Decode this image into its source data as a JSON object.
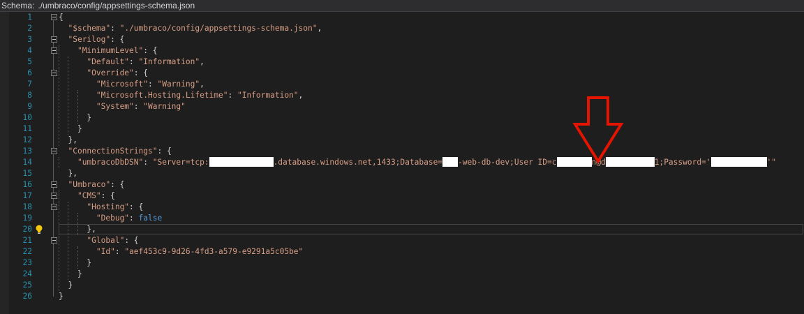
{
  "schema_bar": {
    "label": "Schema:",
    "path": "./umbraco/config/appsettings-schema.json"
  },
  "accent_colors": {
    "key": "#d69d85",
    "string": "#d69d85",
    "keyword": "#569cd6",
    "line_number": "#2b91af",
    "annotation_arrow": "#e51400"
  },
  "lines": [
    {
      "n": "1",
      "t": "{"
    },
    {
      "n": "2",
      "t": "  \"$schema\": \"./umbraco/config/appsettings-schema.json\","
    },
    {
      "n": "3",
      "t": "  \"Serilog\": {"
    },
    {
      "n": "4",
      "t": "    \"MinimumLevel\": {"
    },
    {
      "n": "5",
      "t": "      \"Default\": \"Information\","
    },
    {
      "n": "6",
      "t": "      \"Override\": {"
    },
    {
      "n": "7",
      "t": "        \"Microsoft\": \"Warning\","
    },
    {
      "n": "8",
      "t": "        \"Microsoft.Hosting.Lifetime\": \"Information\","
    },
    {
      "n": "9",
      "t": "        \"System\": \"Warning\""
    },
    {
      "n": "10",
      "t": "      }"
    },
    {
      "n": "11",
      "t": "    }"
    },
    {
      "n": "12",
      "t": "  },"
    },
    {
      "n": "13",
      "t": "  \"ConnectionStrings\": {"
    },
    {
      "n": "14",
      "t": ""
    },
    {
      "n": "15",
      "t": "  },"
    },
    {
      "n": "16",
      "t": "  \"Umbraco\": {"
    },
    {
      "n": "17",
      "t": "    \"CMS\": {"
    },
    {
      "n": "18",
      "t": "      \"Hosting\": {"
    },
    {
      "n": "19",
      "t": ""
    },
    {
      "n": "20",
      "t": "      },"
    },
    {
      "n": "21",
      "t": "      \"Global\": {"
    },
    {
      "n": "22",
      "t": "        \"Id\": \"aef453c9-9d26-4fd3-a579-e9291a5c05be\""
    },
    {
      "n": "23",
      "t": "      }"
    },
    {
      "n": "24",
      "t": "    }"
    },
    {
      "n": "25",
      "t": "  }"
    },
    {
      "n": "26",
      "t": "}"
    }
  ],
  "line14": {
    "key": "\"umbracoDbDSN\"",
    "colon": ": ",
    "seg1": "\"Server=tcp:",
    "seg2": ".database.windows.net,1433;Database=",
    "seg3": "-web-db-dev;User ID=c",
    "seg4": "n@d",
    "seg5": "1;Password='",
    "seg6": "'\""
  },
  "line19": {
    "key": "\"Debug\"",
    "colon": ": ",
    "value": "false"
  },
  "redactions": [
    "redaction-server",
    "redaction-database",
    "redaction-user",
    "redaction-host",
    "redaction-password"
  ]
}
